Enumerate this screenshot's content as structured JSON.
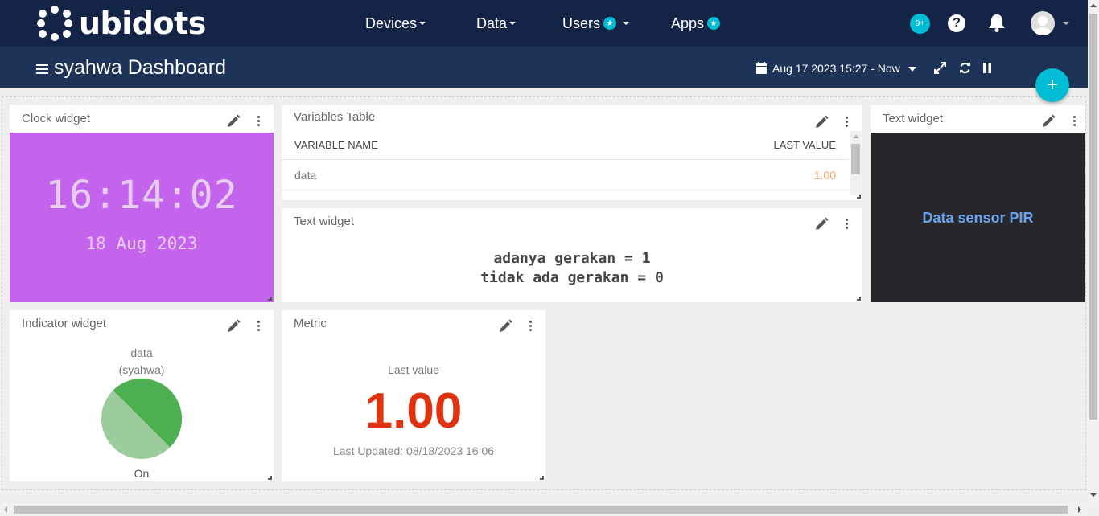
{
  "nav": {
    "brand": "ubidots",
    "devices": "Devices",
    "data": "Data",
    "users": "Users",
    "apps": "Apps",
    "notif_count": "9+",
    "help": "?"
  },
  "dashboard": {
    "title": "syahwa Dashboard",
    "date_range": "Aug 17 2023 15:27 - Now",
    "add_label": "+"
  },
  "clock_widget": {
    "title": "Clock widget",
    "time": "16:14:02",
    "date": "18 Aug 2023",
    "bg_color": "#c463ec"
  },
  "variables_table": {
    "title": "Variables Table",
    "col_name": "VARIABLE NAME",
    "col_value": "LAST VALUE",
    "rows": [
      {
        "name": "data",
        "value": "1.00"
      }
    ]
  },
  "text_widget_mid": {
    "title": "Text widget",
    "line1": "adanya gerakan = 1",
    "line2": "tidak ada gerakan = 0"
  },
  "text_widget_right": {
    "title": "Text widget",
    "text": "Data sensor PIR",
    "bg_color": "#27272b",
    "text_color": "#6ba3ee"
  },
  "indicator_widget": {
    "title": "Indicator widget",
    "variable": "data",
    "device": "(syahwa)",
    "state": "On",
    "on_color": "#4caf50",
    "light_color": "#9ccc9c"
  },
  "metric_widget": {
    "title": "Metric",
    "label": "Last value",
    "value": "1.00",
    "updated": "Last Updated: 08/18/2023 16:06",
    "value_color": "#e0320e"
  },
  "icons": [
    "pencil-icon",
    "kebab-menu-icon",
    "calendar-icon",
    "expand-icon",
    "refresh-icon",
    "pause-icon",
    "bell-icon",
    "help-icon",
    "hamburger-icon"
  ]
}
